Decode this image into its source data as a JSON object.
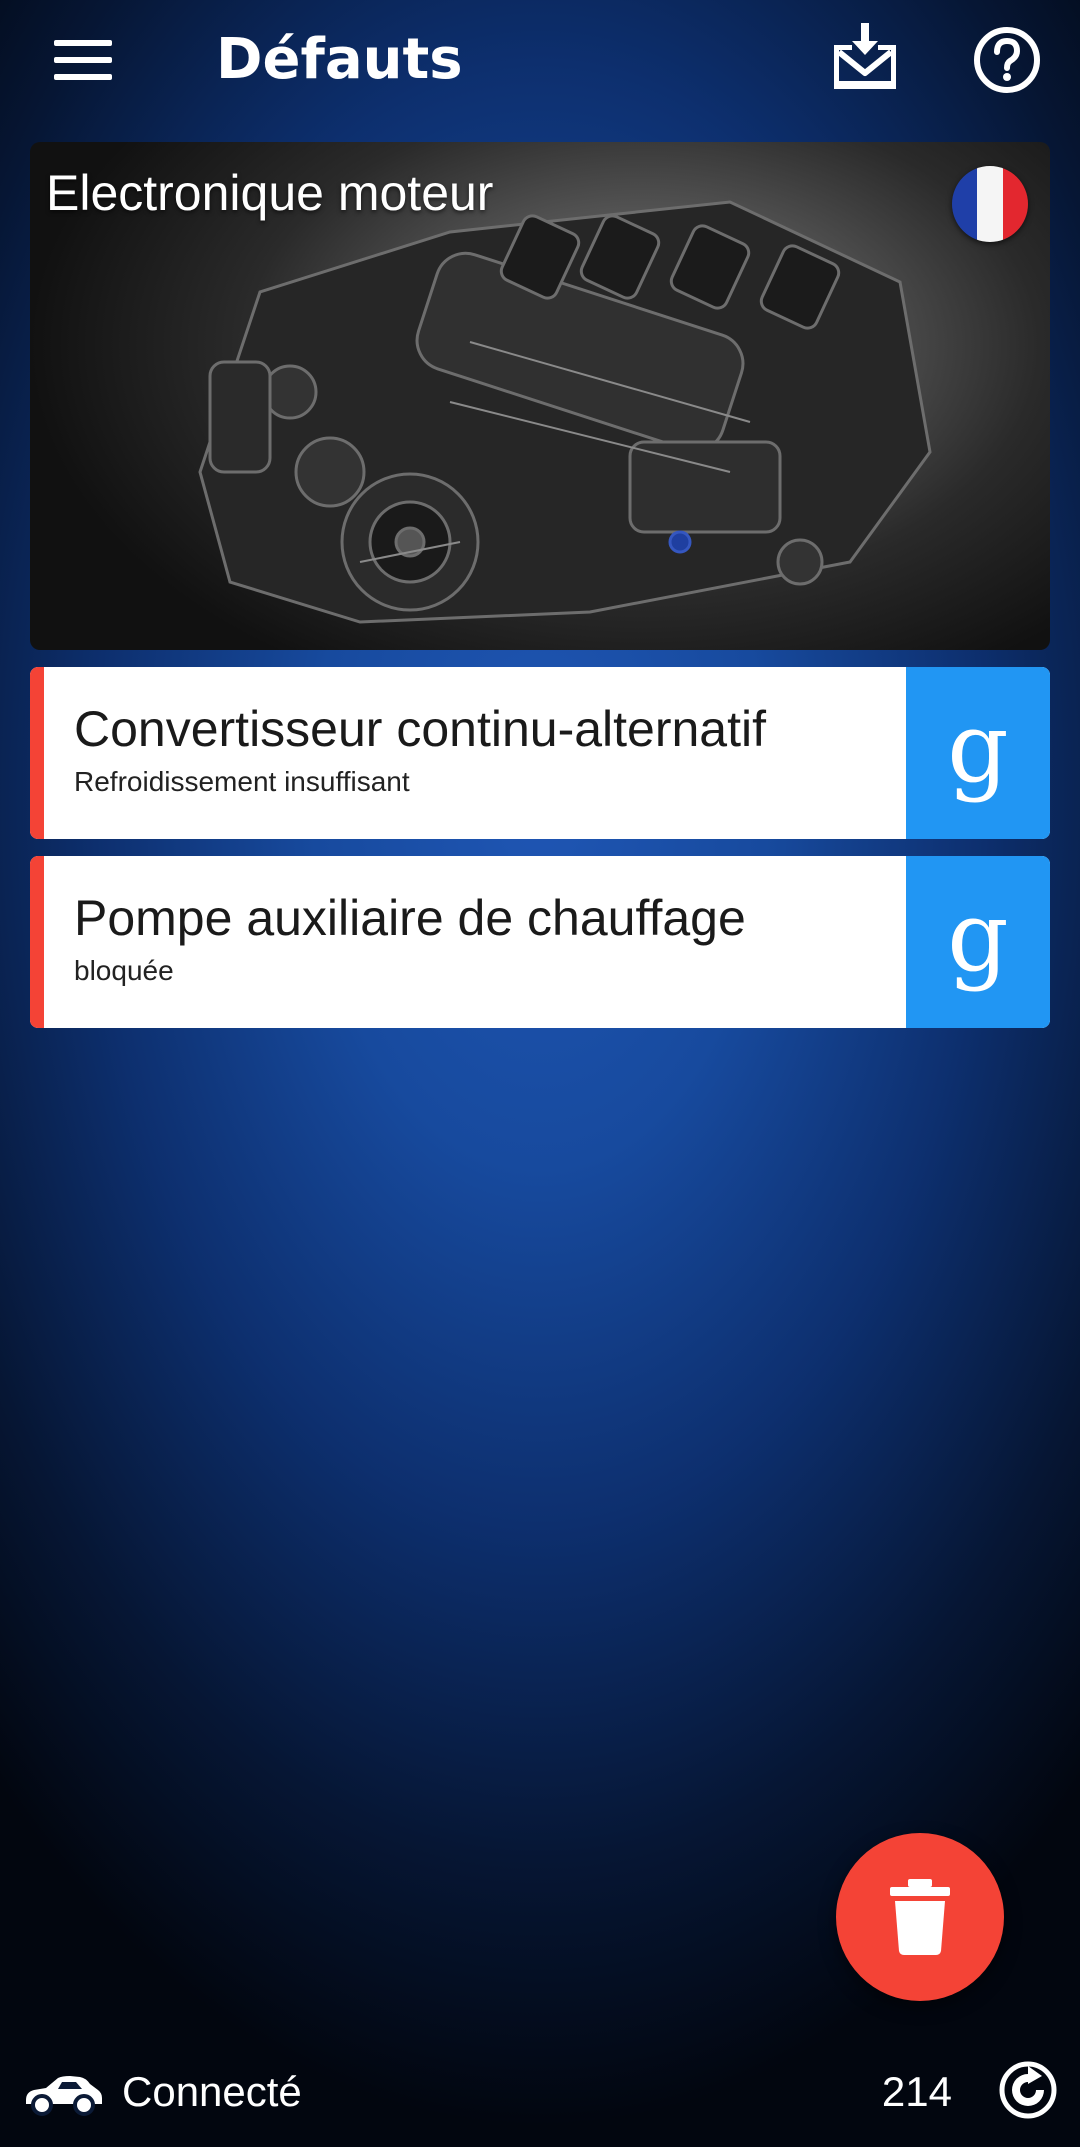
{
  "appbar": {
    "title": "Défauts",
    "menu_icon": "menu-icon",
    "inbox_icon": "inbox-download-icon",
    "help_icon": "help-icon"
  },
  "engine_card": {
    "title": "Electronique moteur",
    "flag": "france-flag-icon"
  },
  "faults": [
    {
      "name": "Convertisseur continu-alternatif",
      "detail": "Refroidissement insuffisant",
      "search_label": "g"
    },
    {
      "name": "Pompe auxiliaire de chauffage",
      "detail": "bloquée",
      "search_label": "g"
    }
  ],
  "fab": {
    "icon": "trash-icon",
    "color": "#f44336"
  },
  "status": {
    "connection": "Connecté",
    "count": "214",
    "car_icon": "car-icon",
    "refresh_icon": "refresh-icon"
  },
  "colors": {
    "accent": "#2196f3",
    "error": "#f44336"
  }
}
